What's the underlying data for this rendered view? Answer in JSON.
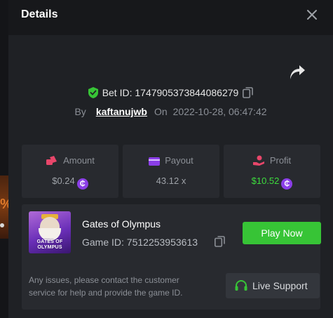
{
  "modal": {
    "title": "Details"
  },
  "bet": {
    "label": "Bet ID: 1747905373844086279",
    "by_label": "By",
    "username": "kaftanujwb",
    "on_label": "On",
    "datetime": "2022-10-28, 06:47:42"
  },
  "stats": [
    {
      "label": "Amount",
      "value": "$0.24",
      "icon": "coins-icon",
      "coin": true,
      "color": "#e8466a"
    },
    {
      "label": "Payout",
      "value": "43.12 x",
      "icon": "wallet-icon",
      "coin": false,
      "color": "#8b3ee8"
    },
    {
      "label": "Profit",
      "value": "$10.52",
      "icon": "hand-coin-icon",
      "coin": true,
      "color": "#e8466a"
    }
  ],
  "game": {
    "name": "Gates of Olympus",
    "id_label": "Game ID: 7512253953613",
    "thumb_line1": "GATES OF",
    "thumb_line2": "OLYMPUS",
    "play_label": "Play Now",
    "issue_text": "Any issues, please contact the customer service for help and provide the game ID.",
    "support_label": "Live Support"
  },
  "coin_glyph": "₵",
  "backdrop_glyph": "%",
  "colors": {
    "green": "#37c436",
    "purple": "#8b3ee8",
    "background": "#1f2125"
  }
}
